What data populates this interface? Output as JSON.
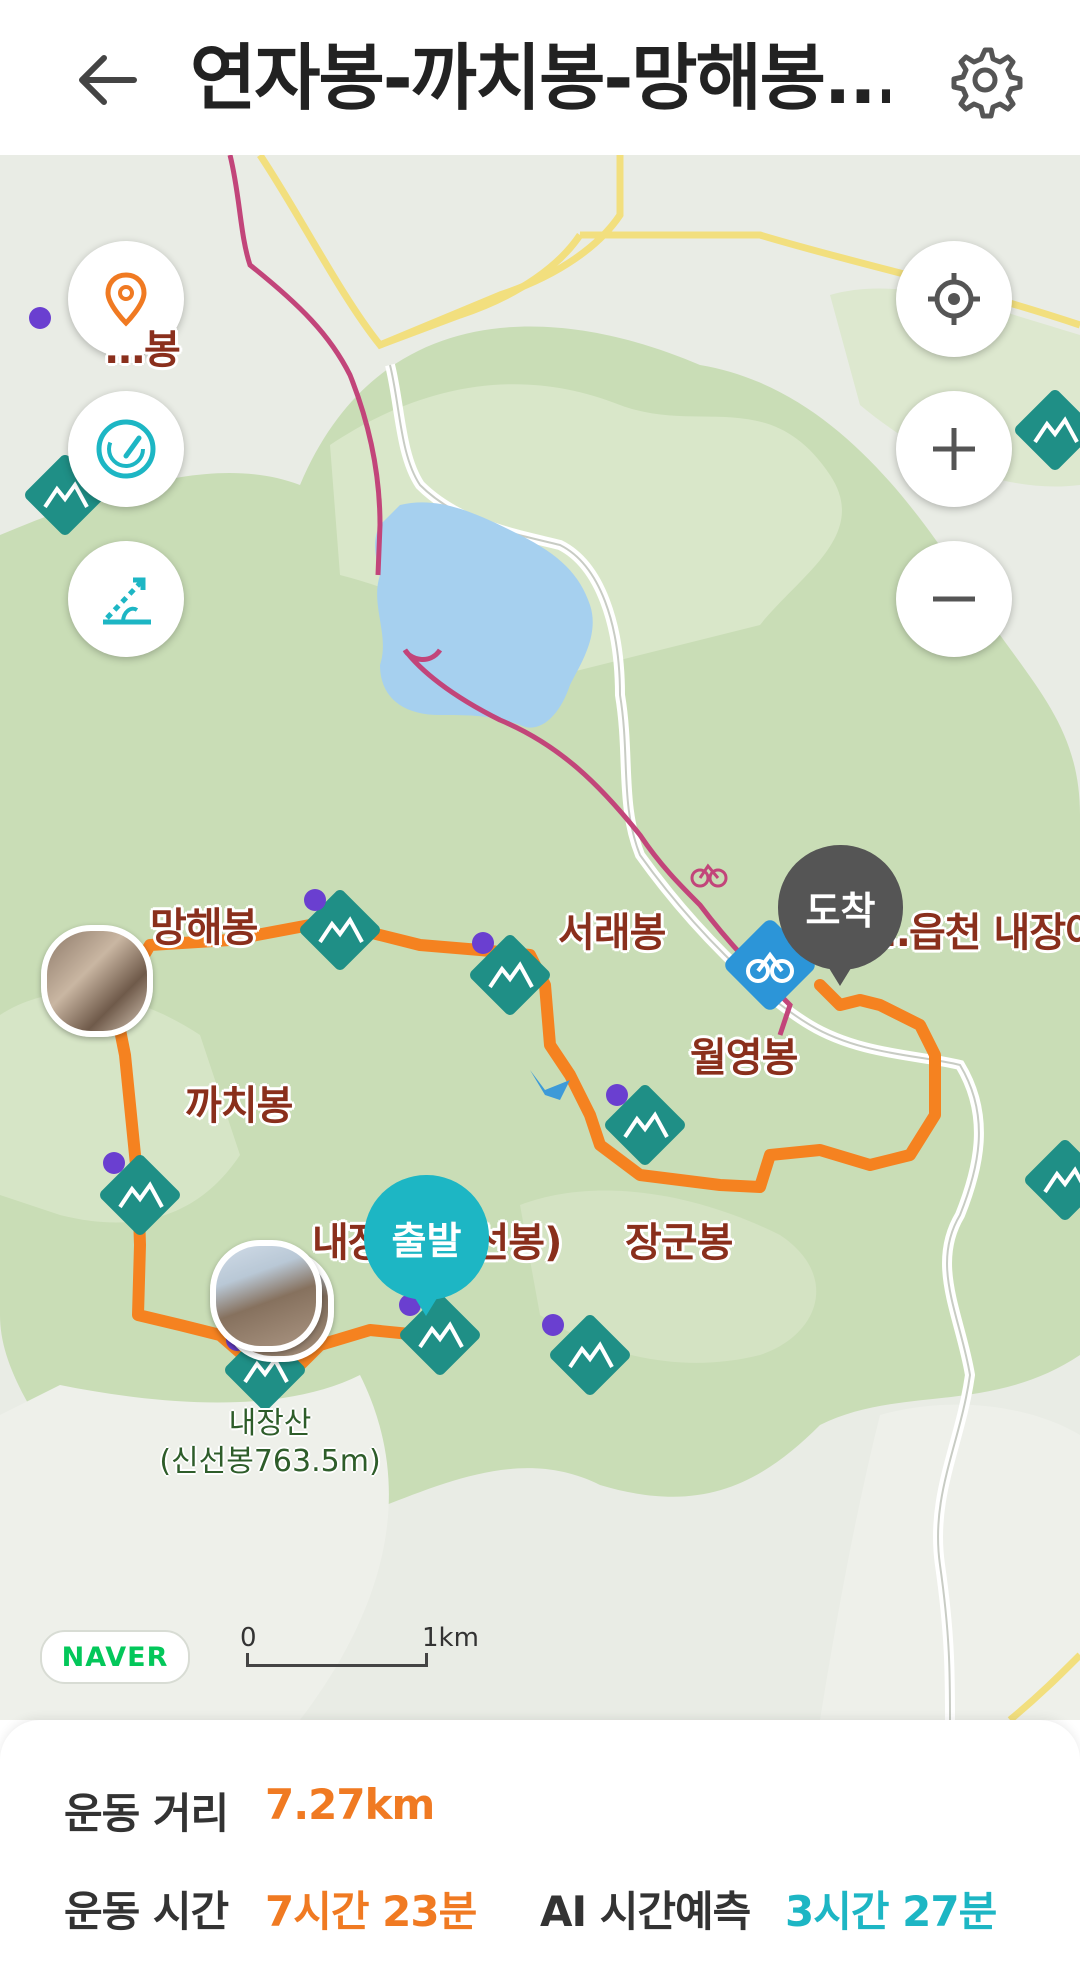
{
  "header": {
    "title": "연자봉-까치봉-망해봉...",
    "back_icon": "arrow-left-icon",
    "settings_icon": "gear-icon"
  },
  "map_controls": {
    "left": [
      "location-pin-icon",
      "speedometer-icon",
      "slope-icon"
    ],
    "right": [
      "my-location-icon",
      "zoom-in-icon",
      "zoom-out-icon"
    ]
  },
  "markers": {
    "start": "출발",
    "end": "도착"
  },
  "peaks": [
    {
      "name": "…봉"
    },
    {
      "name": "망해봉"
    },
    {
      "name": "서래봉"
    },
    {
      "name": "월영봉"
    },
    {
      "name": "까치봉"
    },
    {
      "name": "내장산(신선봉)"
    },
    {
      "name": "장군봉"
    },
    {
      "name": "…읍천 내장아"
    }
  ],
  "peak_detail": {
    "line1": "내장산",
    "line2": "(신선봉763.5m)"
  },
  "map_footer": {
    "provider": "NAVER",
    "scale_start": "0",
    "scale_end": "1km"
  },
  "stats": {
    "distance_label": "운동 거리",
    "distance_value": "7.27km",
    "time_label": "운동 시간",
    "time_value": "7시간 23분",
    "ai_label": "AI 시간예측",
    "ai_value": "3시간 27분"
  },
  "colors": {
    "route": "#f58220",
    "accent_orange": "#f07a22",
    "accent_teal": "#1db6c4",
    "peak_icon": "#1f8f86",
    "end_marker": "#555555"
  }
}
